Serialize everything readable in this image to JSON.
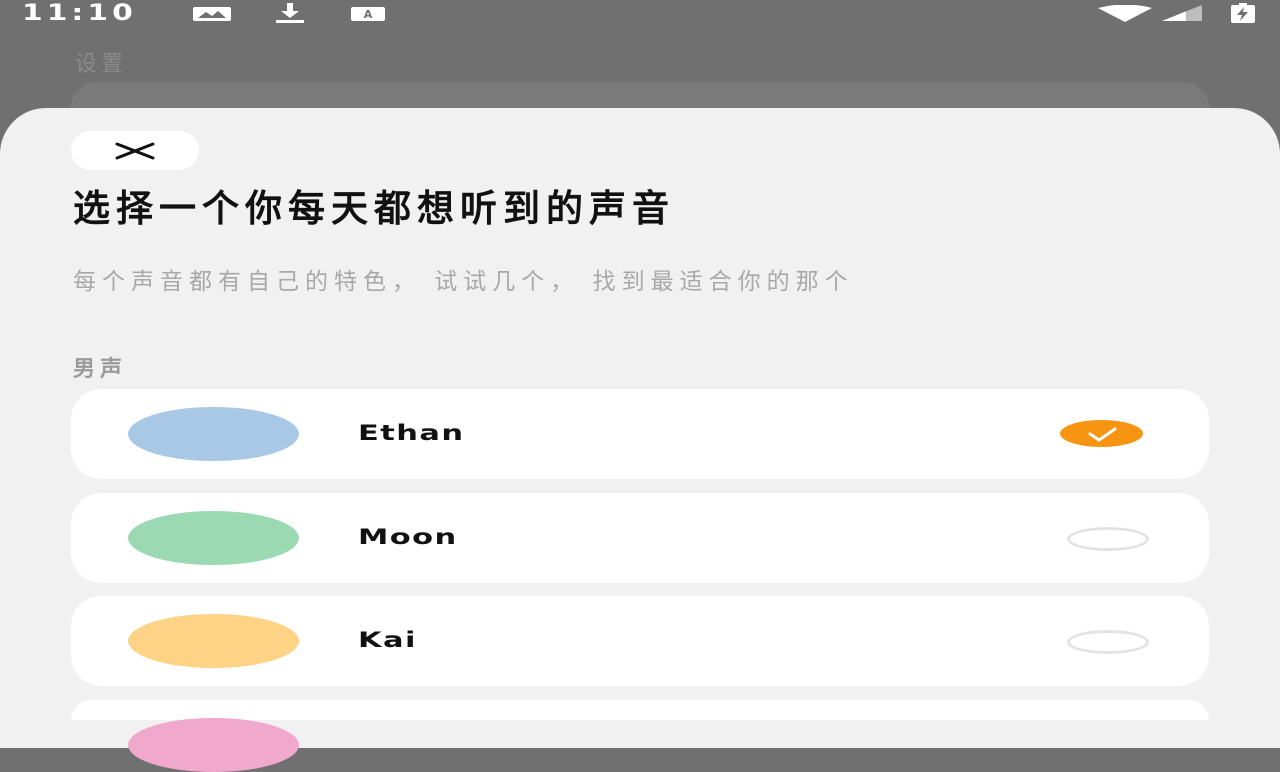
{
  "status_bar": {
    "time": "11:10",
    "left_icons": [
      "image-icon",
      "download-icon",
      "translate-icon"
    ],
    "right_icons": [
      "wifi-icon",
      "signal-icon",
      "battery-charging-icon"
    ]
  },
  "background": {
    "title": "设置"
  },
  "sheet": {
    "close_icon": "close-icon",
    "headline": "选择一个你每天都想听到的声音",
    "subtitle": "每个声音都有自己的特色， 试试几个， 找到最适合你的那个",
    "section_male": "男声"
  },
  "voices": [
    {
      "name": "Ethan",
      "avatar_color": "#a9c8e6",
      "selected": true
    },
    {
      "name": "Moon",
      "avatar_color": "#9ad9b1",
      "selected": false
    },
    {
      "name": "Kai",
      "avatar_color": "#fed385",
      "selected": false
    },
    {
      "name": "",
      "avatar_color": "#f0a8cc",
      "selected": false
    }
  ],
  "colors": {
    "accent": "#f79512",
    "sheet_bg": "#f1f1f1",
    "overlay": "#707070"
  }
}
